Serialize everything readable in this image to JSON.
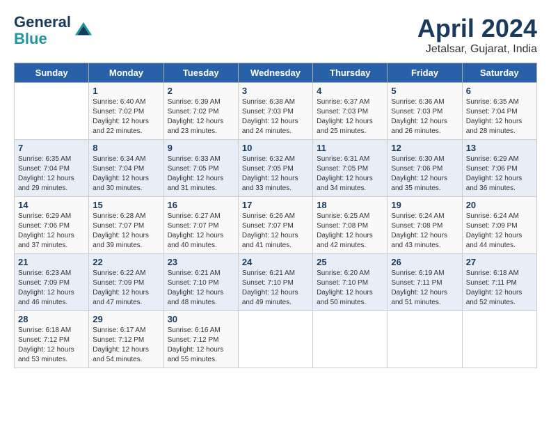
{
  "header": {
    "logo_line1": "General",
    "logo_line2": "Blue",
    "month_year": "April 2024",
    "location": "Jetalsar, Gujarat, India"
  },
  "days_of_week": [
    "Sunday",
    "Monday",
    "Tuesday",
    "Wednesday",
    "Thursday",
    "Friday",
    "Saturday"
  ],
  "weeks": [
    [
      {
        "day": "",
        "sunrise": "",
        "sunset": "",
        "daylight": ""
      },
      {
        "day": "1",
        "sunrise": "Sunrise: 6:40 AM",
        "sunset": "Sunset: 7:02 PM",
        "daylight": "Daylight: 12 hours and 22 minutes."
      },
      {
        "day": "2",
        "sunrise": "Sunrise: 6:39 AM",
        "sunset": "Sunset: 7:02 PM",
        "daylight": "Daylight: 12 hours and 23 minutes."
      },
      {
        "day": "3",
        "sunrise": "Sunrise: 6:38 AM",
        "sunset": "Sunset: 7:03 PM",
        "daylight": "Daylight: 12 hours and 24 minutes."
      },
      {
        "day": "4",
        "sunrise": "Sunrise: 6:37 AM",
        "sunset": "Sunset: 7:03 PM",
        "daylight": "Daylight: 12 hours and 25 minutes."
      },
      {
        "day": "5",
        "sunrise": "Sunrise: 6:36 AM",
        "sunset": "Sunset: 7:03 PM",
        "daylight": "Daylight: 12 hours and 26 minutes."
      },
      {
        "day": "6",
        "sunrise": "Sunrise: 6:35 AM",
        "sunset": "Sunset: 7:04 PM",
        "daylight": "Daylight: 12 hours and 28 minutes."
      }
    ],
    [
      {
        "day": "7",
        "sunrise": "Sunrise: 6:35 AM",
        "sunset": "Sunset: 7:04 PM",
        "daylight": "Daylight: 12 hours and 29 minutes."
      },
      {
        "day": "8",
        "sunrise": "Sunrise: 6:34 AM",
        "sunset": "Sunset: 7:04 PM",
        "daylight": "Daylight: 12 hours and 30 minutes."
      },
      {
        "day": "9",
        "sunrise": "Sunrise: 6:33 AM",
        "sunset": "Sunset: 7:05 PM",
        "daylight": "Daylight: 12 hours and 31 minutes."
      },
      {
        "day": "10",
        "sunrise": "Sunrise: 6:32 AM",
        "sunset": "Sunset: 7:05 PM",
        "daylight": "Daylight: 12 hours and 33 minutes."
      },
      {
        "day": "11",
        "sunrise": "Sunrise: 6:31 AM",
        "sunset": "Sunset: 7:05 PM",
        "daylight": "Daylight: 12 hours and 34 minutes."
      },
      {
        "day": "12",
        "sunrise": "Sunrise: 6:30 AM",
        "sunset": "Sunset: 7:06 PM",
        "daylight": "Daylight: 12 hours and 35 minutes."
      },
      {
        "day": "13",
        "sunrise": "Sunrise: 6:29 AM",
        "sunset": "Sunset: 7:06 PM",
        "daylight": "Daylight: 12 hours and 36 minutes."
      }
    ],
    [
      {
        "day": "14",
        "sunrise": "Sunrise: 6:29 AM",
        "sunset": "Sunset: 7:06 PM",
        "daylight": "Daylight: 12 hours and 37 minutes."
      },
      {
        "day": "15",
        "sunrise": "Sunrise: 6:28 AM",
        "sunset": "Sunset: 7:07 PM",
        "daylight": "Daylight: 12 hours and 39 minutes."
      },
      {
        "day": "16",
        "sunrise": "Sunrise: 6:27 AM",
        "sunset": "Sunset: 7:07 PM",
        "daylight": "Daylight: 12 hours and 40 minutes."
      },
      {
        "day": "17",
        "sunrise": "Sunrise: 6:26 AM",
        "sunset": "Sunset: 7:07 PM",
        "daylight": "Daylight: 12 hours and 41 minutes."
      },
      {
        "day": "18",
        "sunrise": "Sunrise: 6:25 AM",
        "sunset": "Sunset: 7:08 PM",
        "daylight": "Daylight: 12 hours and 42 minutes."
      },
      {
        "day": "19",
        "sunrise": "Sunrise: 6:24 AM",
        "sunset": "Sunset: 7:08 PM",
        "daylight": "Daylight: 12 hours and 43 minutes."
      },
      {
        "day": "20",
        "sunrise": "Sunrise: 6:24 AM",
        "sunset": "Sunset: 7:09 PM",
        "daylight": "Daylight: 12 hours and 44 minutes."
      }
    ],
    [
      {
        "day": "21",
        "sunrise": "Sunrise: 6:23 AM",
        "sunset": "Sunset: 7:09 PM",
        "daylight": "Daylight: 12 hours and 46 minutes."
      },
      {
        "day": "22",
        "sunrise": "Sunrise: 6:22 AM",
        "sunset": "Sunset: 7:09 PM",
        "daylight": "Daylight: 12 hours and 47 minutes."
      },
      {
        "day": "23",
        "sunrise": "Sunrise: 6:21 AM",
        "sunset": "Sunset: 7:10 PM",
        "daylight": "Daylight: 12 hours and 48 minutes."
      },
      {
        "day": "24",
        "sunrise": "Sunrise: 6:21 AM",
        "sunset": "Sunset: 7:10 PM",
        "daylight": "Daylight: 12 hours and 49 minutes."
      },
      {
        "day": "25",
        "sunrise": "Sunrise: 6:20 AM",
        "sunset": "Sunset: 7:10 PM",
        "daylight": "Daylight: 12 hours and 50 minutes."
      },
      {
        "day": "26",
        "sunrise": "Sunrise: 6:19 AM",
        "sunset": "Sunset: 7:11 PM",
        "daylight": "Daylight: 12 hours and 51 minutes."
      },
      {
        "day": "27",
        "sunrise": "Sunrise: 6:18 AM",
        "sunset": "Sunset: 7:11 PM",
        "daylight": "Daylight: 12 hours and 52 minutes."
      }
    ],
    [
      {
        "day": "28",
        "sunrise": "Sunrise: 6:18 AM",
        "sunset": "Sunset: 7:12 PM",
        "daylight": "Daylight: 12 hours and 53 minutes."
      },
      {
        "day": "29",
        "sunrise": "Sunrise: 6:17 AM",
        "sunset": "Sunset: 7:12 PM",
        "daylight": "Daylight: 12 hours and 54 minutes."
      },
      {
        "day": "30",
        "sunrise": "Sunrise: 6:16 AM",
        "sunset": "Sunset: 7:12 PM",
        "daylight": "Daylight: 12 hours and 55 minutes."
      },
      {
        "day": "",
        "sunrise": "",
        "sunset": "",
        "daylight": ""
      },
      {
        "day": "",
        "sunrise": "",
        "sunset": "",
        "daylight": ""
      },
      {
        "day": "",
        "sunrise": "",
        "sunset": "",
        "daylight": ""
      },
      {
        "day": "",
        "sunrise": "",
        "sunset": "",
        "daylight": ""
      }
    ]
  ]
}
